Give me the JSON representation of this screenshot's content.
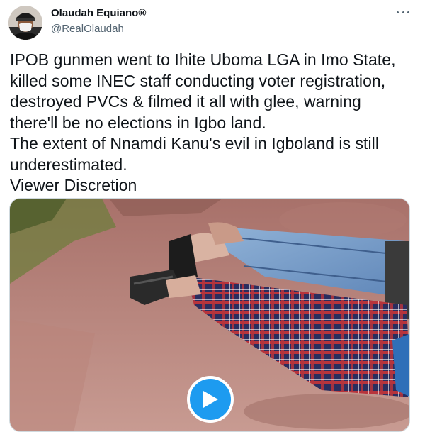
{
  "author": {
    "display_name": "Olaudah Equiano®",
    "handle": "@RealOlaudah",
    "avatar_icon": "profile-avatar-icon"
  },
  "tweet": {
    "text": "IPOB gunmen went to Ihite Uboma LGA in Imo State,\nkilled some INEC staff conducting voter registration,\ndestroyed PVCs & filmed it all with glee, warning\nthere'll be no elections in Igbo land.\nThe extent of Nnamdi Kanu's evil in Igboland is still\nunderestimated.\nViewer Discretion"
  },
  "media": {
    "type": "video",
    "play_icon": "play-icon"
  },
  "more_icon": "more-horizontal-icon",
  "colors": {
    "accent": "#1d9bf0",
    "secondary_text": "#536471",
    "primary_text": "#0f1419"
  }
}
